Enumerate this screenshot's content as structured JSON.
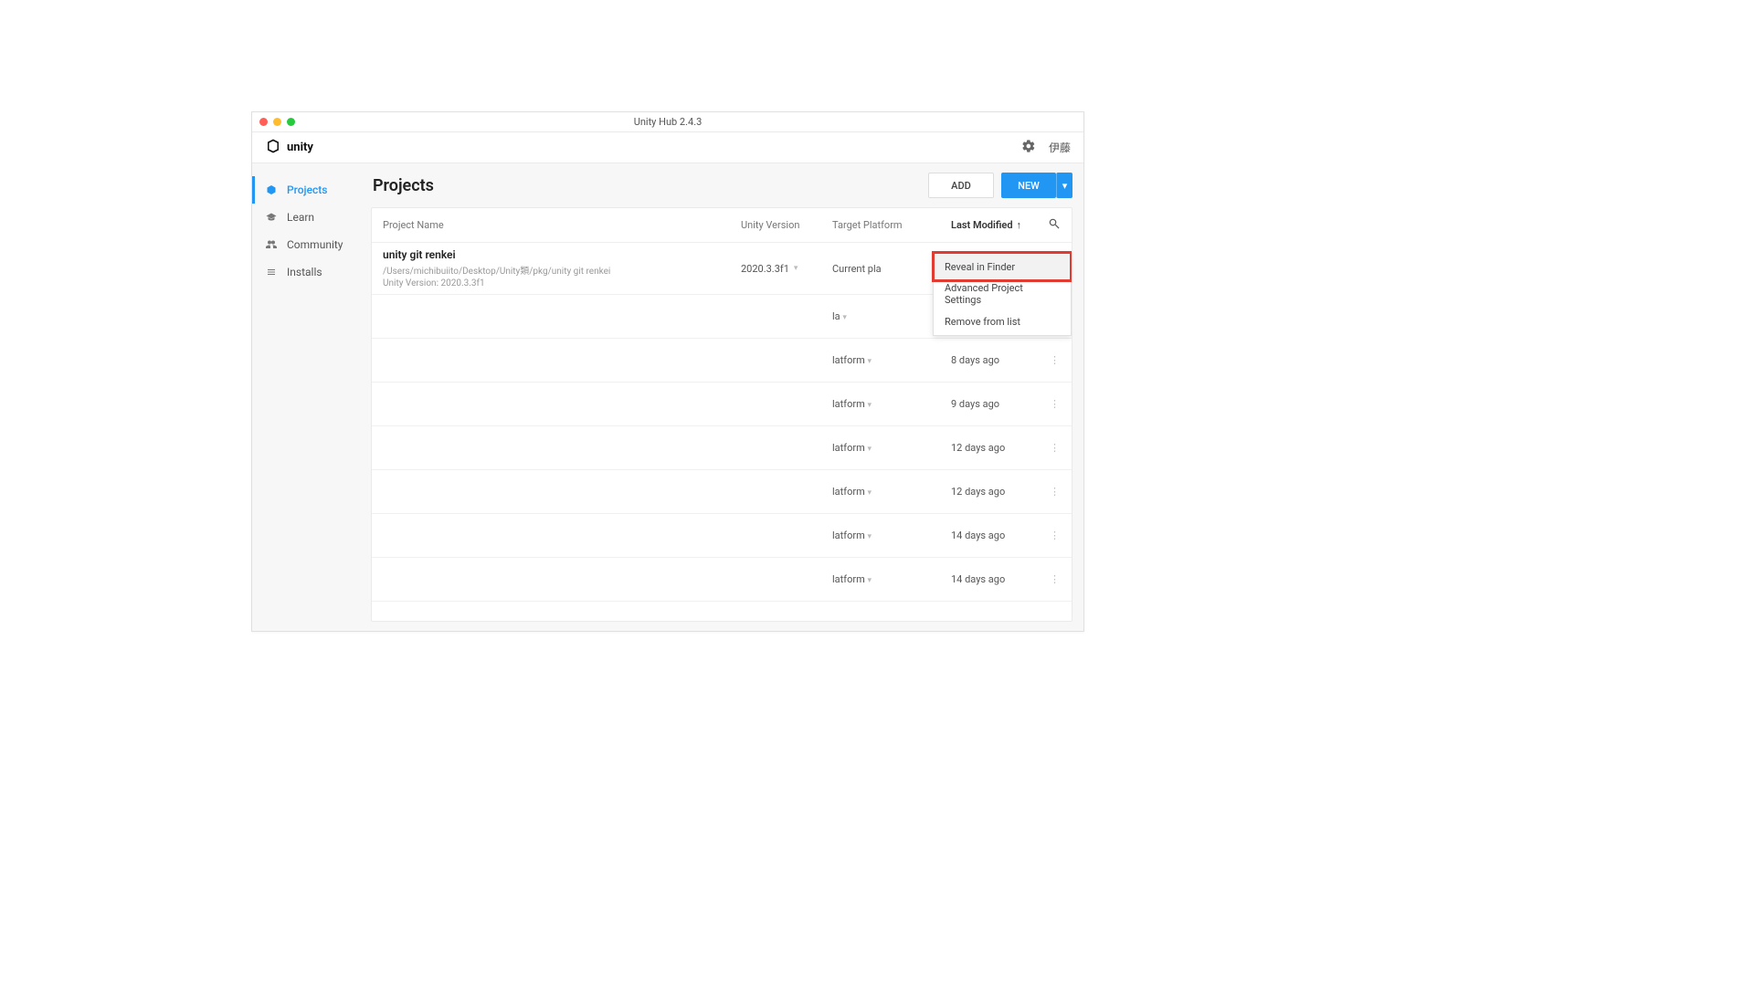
{
  "window": {
    "title": "Unity Hub 2.4.3"
  },
  "header": {
    "brand": "unity",
    "user": "伊藤"
  },
  "sidebar": {
    "items": [
      {
        "label": "Projects",
        "active": true
      },
      {
        "label": "Learn"
      },
      {
        "label": "Community"
      },
      {
        "label": "Installs"
      }
    ]
  },
  "page": {
    "title": "Projects",
    "add_label": "ADD",
    "new_label": "NEW"
  },
  "columns": {
    "name": "Project Name",
    "version": "Unity Version",
    "platform": "Target Platform",
    "modified": "Last Modified"
  },
  "project_first": {
    "name": "unity git renkei",
    "path": "/Users/michibuiito/Desktop/Unity類/pkg/unity git renkei",
    "version_line": "Unity Version: 2020.3.3f1",
    "version": "2020.3.3f1",
    "platform": "Current pla"
  },
  "rows_partial": [
    {
      "platform": "la",
      "modified": ""
    },
    {
      "platform": "latform",
      "modified": "8 days ago"
    },
    {
      "platform": "latform",
      "modified": "9 days ago"
    },
    {
      "platform": "latform",
      "modified": "12 days ago"
    },
    {
      "platform": "latform",
      "modified": "12 days ago"
    },
    {
      "platform": "latform",
      "modified": "14 days ago"
    },
    {
      "platform": "latform",
      "modified": "14 days ago"
    }
  ],
  "context_menu": {
    "items": [
      "Reveal in Finder",
      "Advanced Project Settings",
      "Remove from list"
    ]
  }
}
